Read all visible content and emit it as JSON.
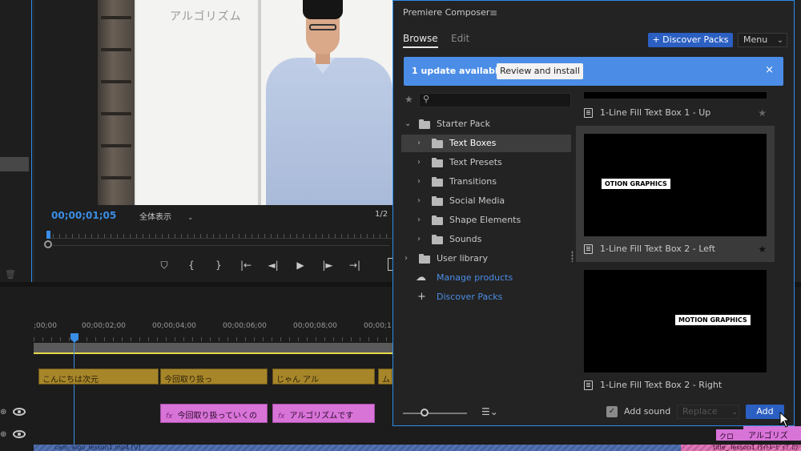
{
  "program": {
    "board_text": "アルゴリズム",
    "timecode": "00;00;01;05",
    "fit_label": "全体表示",
    "page_indicator": "1/2"
  },
  "transport": {
    "marker": "⛉",
    "in": "{",
    "out": "}",
    "go_in": "|←",
    "step_back": "◄|",
    "play": "▶",
    "step_fwd": "|►",
    "go_out": "→|"
  },
  "timeline": {
    "ruler": [
      ";00;00",
      "00;00;02;00",
      "00;00;04;00",
      "00;00;06;00",
      "00;00;08;00",
      "00;00;1"
    ],
    "video_clips": [
      "こんにちは次元",
      "今回取り扱っ",
      "じゃん アル",
      "ム"
    ],
    "pink_clips": [
      "今回取り扱っていくの",
      "アルゴリズムです"
    ],
    "fx_label": "fx",
    "audio_label": "cam_algo_lesson1.mp4 [V]",
    "audio_label2": "title_ lesson1 (ﾀｲﾄﾙｰｾﾞｲﾌﾟﾛｸﾞ",
    "right_clip1": "クロス",
    "right_clip2": "アルゴリズ"
  },
  "composer": {
    "title": "Premiere Composer",
    "menu_glyph": "≡",
    "tabs": {
      "browse": "Browse",
      "edit": "Edit"
    },
    "discover_button": "+ Discover Packs",
    "menu_button": "Menu",
    "banner": {
      "message": "1 update available",
      "review_button": "Review and install",
      "close": "×"
    },
    "tree": [
      {
        "label": "Starter Pack"
      },
      {
        "label": "Text Boxes"
      },
      {
        "label": "Text Presets"
      },
      {
        "label": "Transitions"
      },
      {
        "label": "Social Media"
      },
      {
        "label": "Shape Elements"
      },
      {
        "label": "Sounds"
      },
      {
        "label": "User library"
      },
      {
        "label": "Manage products"
      },
      {
        "label": "Discover Packs"
      }
    ],
    "cards": [
      {
        "name": "1-Line Fill Text Box 1 - Up",
        "overlay": ""
      },
      {
        "name": "1-Line Fill Text Box 2 - Left",
        "overlay": "OTION GRAPHICS"
      },
      {
        "name": "1-Line Fill Text Box 2 - Right",
        "overlay": "MOTION GRAPHICS"
      }
    ],
    "footer": {
      "add_sound": "Add sound",
      "add_sound_checked": true,
      "replace": "Replace",
      "add": "Add"
    },
    "accent_color": "#2b5fc2",
    "banner_color": "#4b8de6"
  }
}
